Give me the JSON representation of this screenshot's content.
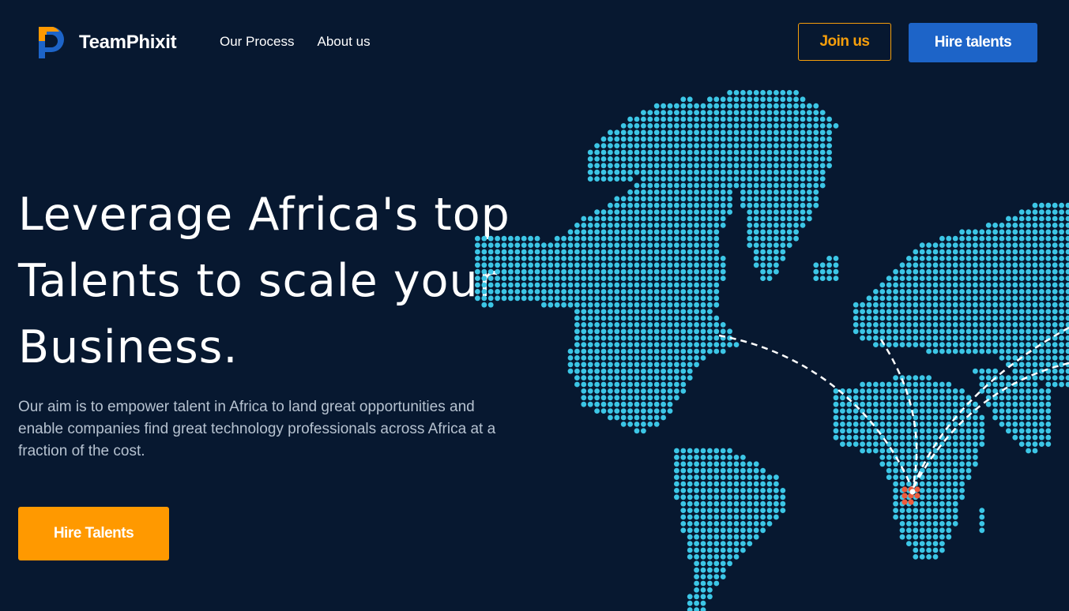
{
  "brand": {
    "name": "TeamPhixit",
    "colors": {
      "primary": "#1d64c8",
      "accent": "#ff9900",
      "background": "#071830",
      "map_dot": "#3cc6e6",
      "highlight_dot": "#ef5b3c"
    }
  },
  "nav": {
    "items": [
      {
        "label": "Our Process"
      },
      {
        "label": "About us"
      }
    ]
  },
  "header_actions": {
    "join_label": "Join us",
    "hire_label": "Hire talents"
  },
  "hero": {
    "headline": "Leverage Africa's top Talents to scale your Business.",
    "description": "Our aim is to empower talent in Africa to land great opportunities and enable companies find great technology professionals across Africa at a fraction of the cost.",
    "cta_label": "Hire Talents"
  },
  "illustration": {
    "type": "dotted-world-map",
    "highlight": "Africa talent hub with connection arcs"
  }
}
